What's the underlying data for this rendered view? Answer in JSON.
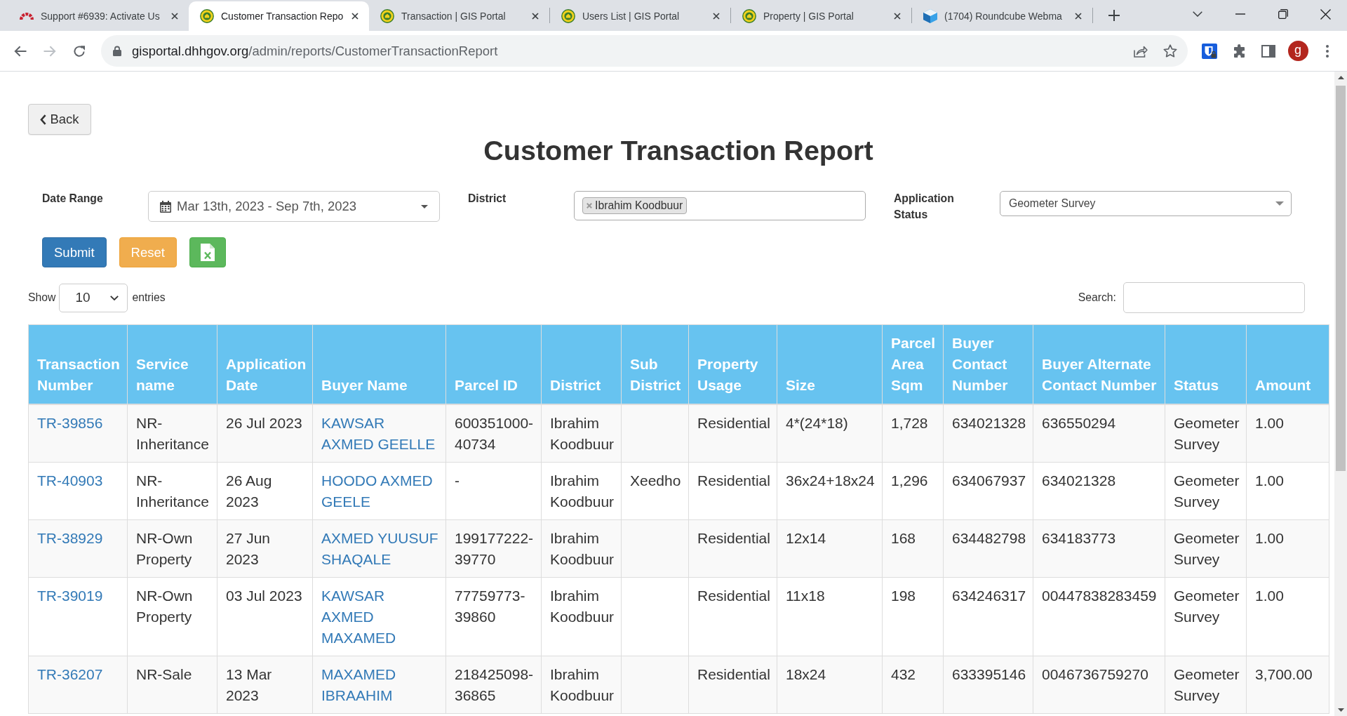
{
  "browser": {
    "tabs": [
      {
        "title": "Support #6939: Activate Us",
        "kind": "arc",
        "selected": false
      },
      {
        "title": "Customer Transaction Repo",
        "kind": "seal",
        "selected": true
      },
      {
        "title": "Transaction | GIS Portal",
        "kind": "seal",
        "selected": false
      },
      {
        "title": "Users List | GIS Portal",
        "kind": "seal",
        "selected": false
      },
      {
        "title": "Property | GIS Portal",
        "kind": "seal",
        "selected": false
      },
      {
        "title": "(1704) Roundcube Webma",
        "kind": "cube",
        "selected": false
      }
    ],
    "back": {
      "disabled": false
    },
    "forward": {
      "disabled": true
    },
    "address": {
      "host": "gisportal.dhhgov.org",
      "path": "/admin/reports/CustomerTransactionReport"
    },
    "profile": {
      "initial": "g"
    }
  },
  "page": {
    "back_button": {
      "label": "Back"
    },
    "title": "Customer Transaction Report",
    "filters": [
      {
        "kind": "daterange",
        "label": "Date Range",
        "value": "Mar 13th, 2023 - Sep 7th, 2023"
      },
      {
        "kind": "tags",
        "label": "District",
        "tags": [
          "Ibrahim Koodbuur"
        ]
      },
      {
        "kind": "select",
        "label": "Application Status",
        "value": "Geometer Survey"
      }
    ],
    "actions": [
      {
        "kind": "submit",
        "label": "Submit"
      },
      {
        "kind": "reset",
        "label": "Reset"
      },
      {
        "kind": "export"
      }
    ],
    "length_menu": {
      "before": "Show",
      "value": "10",
      "after": "entries"
    },
    "search": {
      "label": "Search:"
    },
    "table": {
      "columns": [
        {
          "label": "Transaction Number",
          "kind": "link"
        },
        {
          "label": "Service name",
          "kind": "text"
        },
        {
          "label": "Application Date",
          "kind": "text"
        },
        {
          "label": "Buyer Name",
          "kind": "link"
        },
        {
          "label": "Parcel ID",
          "kind": "text"
        },
        {
          "label": "District",
          "kind": "text"
        },
        {
          "label": "Sub District",
          "kind": "text"
        },
        {
          "label": "Property Usage",
          "kind": "text"
        },
        {
          "label": "Size",
          "kind": "text"
        },
        {
          "label": "Parcel Area Sqm",
          "kind": "text"
        },
        {
          "label": "Buyer Contact Number",
          "kind": "text"
        },
        {
          "label": "Buyer Alternate Contact Number",
          "kind": "text"
        },
        {
          "label": "Status",
          "kind": "text"
        },
        {
          "label": "Amount",
          "kind": "text"
        }
      ],
      "rows": [
        [
          "TR-39856",
          "NR-Inheritance",
          "26 Jul 2023",
          "KAWSAR AXMED GEELLE",
          "600351000-40734",
          "Ibrahim Koodbuur",
          null,
          "Residential",
          "4*(24*18)",
          "1,728",
          "634021328",
          "636550294",
          "Geometer Survey",
          "1.00"
        ],
        [
          "TR-40903",
          "NR-Inheritance",
          "26 Aug 2023",
          "HOODO AXMED GEELE",
          "-",
          "Ibrahim Koodbuur",
          "Xeedho",
          "Residential",
          "36x24+18x24",
          "1,296",
          "634067937",
          "634021328",
          "Geometer Survey",
          "1.00"
        ],
        [
          "TR-38929",
          "NR-Own Property",
          "27 Jun 2023",
          "AXMED YUUSUF SHAQALE",
          "199177222-39770",
          "Ibrahim Koodbuur",
          null,
          "Residential",
          "12x14",
          "168",
          "634482798",
          "634183773",
          "Geometer Survey",
          "1.00"
        ],
        [
          "TR-39019",
          "NR-Own Property",
          "03 Jul 2023",
          "KAWSAR AXMED MAXAMED",
          "77759773-39860",
          "Ibrahim Koodbuur",
          null,
          "Residential",
          "11x18",
          "198",
          "634246317",
          "00447838283459",
          "Geometer Survey",
          "1.00"
        ],
        [
          "TR-36207",
          "NR-Sale",
          "13 Mar 2023",
          "MAXAMED IBRAAHIM",
          "218425098-36865",
          "Ibrahim Koodbuur",
          null,
          "Residential",
          "18x24",
          "432",
          "633395146",
          "0046736759270",
          "Geometer Survey",
          "3,700.00"
        ]
      ]
    }
  }
}
